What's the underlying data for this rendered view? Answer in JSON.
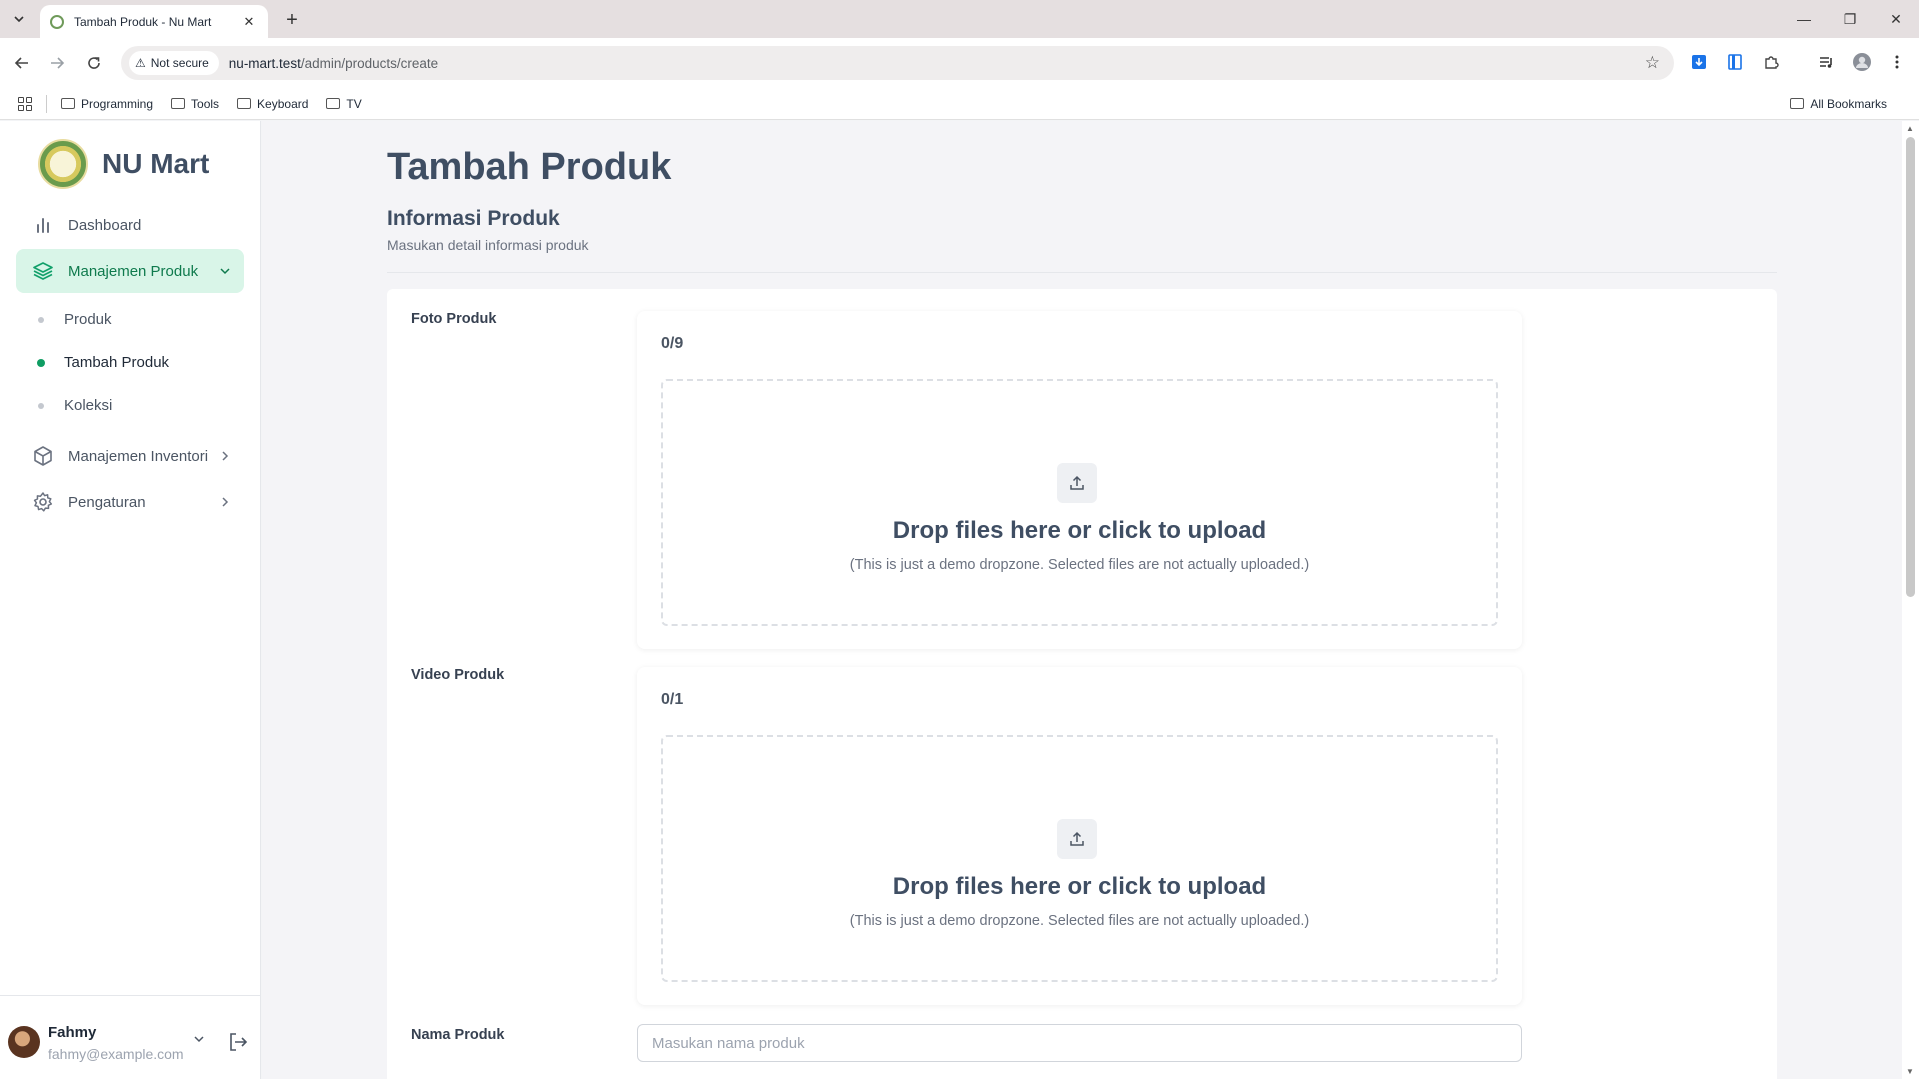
{
  "browser": {
    "tab_title": "Tambah Produk - Nu Mart",
    "security_label": "Not secure",
    "url_host": "nu-mart.test",
    "url_path": "/admin/products/create",
    "bookmarks": [
      "Programming",
      "Tools",
      "Keyboard",
      "TV"
    ],
    "all_bookmarks": "All Bookmarks"
  },
  "sidebar": {
    "brand": "NU Mart",
    "nav": {
      "dashboard": "Dashboard",
      "manajemen_produk": "Manajemen Produk",
      "produk": "Produk",
      "tambah_produk": "Tambah Produk",
      "koleksi": "Koleksi",
      "manajemen_inventori": "Manajemen Inventori",
      "pengaturan": "Pengaturan"
    },
    "user": {
      "name": "Fahmy",
      "email": "fahmy@example.com"
    }
  },
  "main": {
    "page_title": "Tambah Produk",
    "section_title": "Informasi Produk",
    "section_subtitle": "Masukan detail informasi produk",
    "foto": {
      "label": "Foto Produk",
      "count": "0/9",
      "dz_title": "Drop files here or click to upload",
      "dz_hint": "(This is just a demo dropzone. Selected files are not actually uploaded.)"
    },
    "video": {
      "label": "Video Produk",
      "count": "0/1",
      "dz_title": "Drop files here or click to upload",
      "dz_hint": "(This is just a demo dropzone. Selected files are not actually uploaded.)"
    },
    "nama": {
      "label": "Nama Produk",
      "value": "",
      "placeholder": "Masukan nama produk"
    }
  },
  "colors": {
    "accent": "#0f9d63",
    "active_bg": "#d9f5e8",
    "heading": "#3f4e63"
  }
}
